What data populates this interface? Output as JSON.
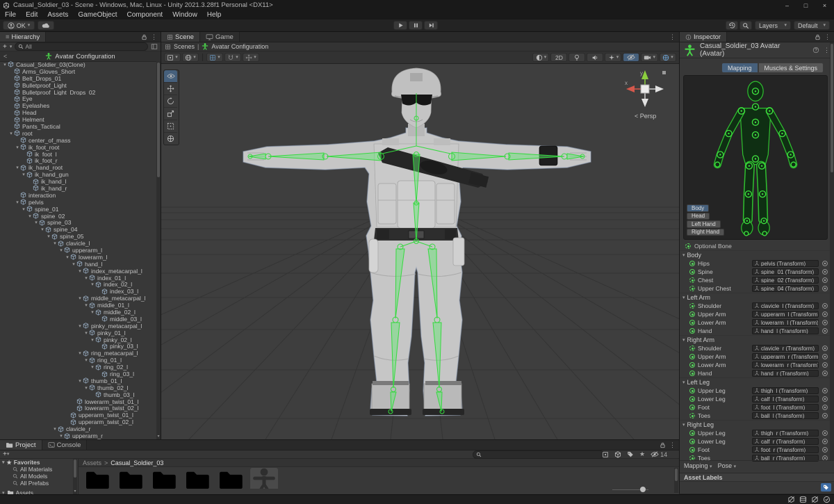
{
  "titlebar": {
    "title": "Casual_Soldier_03 - Scene - Windows, Mac, Linux - Unity 2021.3.28f1 Personal <DX11>"
  },
  "menubar": {
    "items": [
      {
        "label": "File"
      },
      {
        "label": "Edit"
      },
      {
        "label": "Assets"
      },
      {
        "label": "GameObject"
      },
      {
        "label": "Component"
      },
      {
        "label": "Window"
      },
      {
        "label": "Help"
      }
    ]
  },
  "toolbar": {
    "account": "OK",
    "layers": "Layers",
    "layout": "Default"
  },
  "glyphs": {
    "caret": "▾",
    "caret_right": "▸",
    "kebab": "⋮",
    "burger": "≡",
    "plus": "+",
    "star": "★",
    "back": "<",
    "pipe": "|",
    "crumb": ">",
    "minimize": "–",
    "maximize": "□",
    "close": "×"
  },
  "hierarchy": {
    "tab": "Hierarchy",
    "search_value": "All",
    "header": "Avatar Configuration",
    "items": [
      {
        "label": "Casual_Soldier_03(Clone)",
        "depth": 0,
        "expanded": true
      },
      {
        "label": "Arms_Gloves_Short",
        "depth": 1,
        "expanded": false
      },
      {
        "label": "Belt_Drops_01",
        "depth": 1,
        "expanded": false
      },
      {
        "label": "Bulletproof_Light",
        "depth": 1,
        "expanded": false
      },
      {
        "label": "Bulletproof_Light_Drops_02",
        "depth": 1,
        "expanded": false
      },
      {
        "label": "Eye",
        "depth": 1,
        "expanded": false
      },
      {
        "label": "Eyelashes",
        "depth": 1,
        "expanded": false
      },
      {
        "label": "Head",
        "depth": 1,
        "expanded": false
      },
      {
        "label": "Helment",
        "depth": 1,
        "expanded": false
      },
      {
        "label": "Pants_Tactical",
        "depth": 1,
        "expanded": false
      },
      {
        "label": "root",
        "depth": 1,
        "expanded": true
      },
      {
        "label": "center_of_mass",
        "depth": 2,
        "expanded": false
      },
      {
        "label": "ik_foot_root",
        "depth": 2,
        "expanded": true
      },
      {
        "label": "ik_foot_l",
        "depth": 3,
        "expanded": false
      },
      {
        "label": "ik_foot_r",
        "depth": 3,
        "expanded": false
      },
      {
        "label": "ik_hand_root",
        "depth": 2,
        "expanded": true
      },
      {
        "label": "ik_hand_gun",
        "depth": 3,
        "expanded": true
      },
      {
        "label": "ik_hand_l",
        "depth": 4,
        "expanded": false
      },
      {
        "label": "ik_hand_r",
        "depth": 4,
        "expanded": false
      },
      {
        "label": "interaction",
        "depth": 2,
        "expanded": false
      },
      {
        "label": "pelvis",
        "depth": 2,
        "expanded": true
      },
      {
        "label": "spine_01",
        "depth": 3,
        "expanded": true
      },
      {
        "label": "spine_02",
        "depth": 4,
        "expanded": true
      },
      {
        "label": "spine_03",
        "depth": 5,
        "expanded": true
      },
      {
        "label": "spine_04",
        "depth": 6,
        "expanded": true
      },
      {
        "label": "spine_05",
        "depth": 7,
        "expanded": true
      },
      {
        "label": "clavicle_l",
        "depth": 8,
        "expanded": true
      },
      {
        "label": "upperarm_l",
        "depth": 9,
        "expanded": true
      },
      {
        "label": "lowerarm_l",
        "depth": 10,
        "expanded": true
      },
      {
        "label": "hand_l",
        "depth": 11,
        "expanded": true
      },
      {
        "label": "index_metacarpal_l",
        "depth": 12,
        "expanded": true
      },
      {
        "label": "index_01_l",
        "depth": 13,
        "expanded": true
      },
      {
        "label": "index_02_l",
        "depth": 14,
        "expanded": true
      },
      {
        "label": "index_03_l",
        "depth": 15,
        "expanded": false
      },
      {
        "label": "middle_metacarpal_l",
        "depth": 12,
        "expanded": true
      },
      {
        "label": "middle_01_l",
        "depth": 13,
        "expanded": true
      },
      {
        "label": "middle_02_l",
        "depth": 14,
        "expanded": true
      },
      {
        "label": "middle_03_l",
        "depth": 15,
        "expanded": false
      },
      {
        "label": "pinky_metacarpal_l",
        "depth": 12,
        "expanded": true
      },
      {
        "label": "pinky_01_l",
        "depth": 13,
        "expanded": true
      },
      {
        "label": "pinky_02_l",
        "depth": 14,
        "expanded": true
      },
      {
        "label": "pinky_03_l",
        "depth": 15,
        "expanded": false
      },
      {
        "label": "ring_metacarpal_l",
        "depth": 12,
        "expanded": true
      },
      {
        "label": "ring_01_l",
        "depth": 13,
        "expanded": true
      },
      {
        "label": "ring_02_l",
        "depth": 14,
        "expanded": true
      },
      {
        "label": "ring_03_l",
        "depth": 15,
        "expanded": false
      },
      {
        "label": "thumb_01_l",
        "depth": 12,
        "expanded": true
      },
      {
        "label": "thumb_02_l",
        "depth": 13,
        "expanded": true
      },
      {
        "label": "thumb_03_l",
        "depth": 14,
        "expanded": false
      },
      {
        "label": "lowerarm_twist_01_l",
        "depth": 11,
        "expanded": false
      },
      {
        "label": "lowerarm_twist_02_l",
        "depth": 11,
        "expanded": false
      },
      {
        "label": "upperarm_twist_01_l",
        "depth": 10,
        "expanded": false
      },
      {
        "label": "upperarm_twist_02_l",
        "depth": 10,
        "expanded": false
      },
      {
        "label": "clavicle_r",
        "depth": 8,
        "expanded": true
      },
      {
        "label": "upperarm_r",
        "depth": 9,
        "expanded": true
      }
    ]
  },
  "scene": {
    "tab_scene": "Scene",
    "tab_game": "Game",
    "breadcrumb_scenes": "Scenes",
    "breadcrumb_config": "Avatar Configuration",
    "mode_2d": "2D",
    "gizmo": {
      "persp": "< Persp",
      "x": "x",
      "y": "y"
    }
  },
  "inspector": {
    "tab": "Inspector",
    "title": "Casual_Soldier_03 Avatar (Avatar)",
    "tab_mapping": "Mapping",
    "tab_muscles": "Muscles & Settings",
    "body_part_buttons": [
      {
        "label": "Body",
        "active": true
      },
      {
        "label": "Head",
        "active": false
      },
      {
        "label": "Left Hand",
        "active": false
      },
      {
        "label": "Right Hand",
        "active": false
      }
    ],
    "optional_bone": "Optional Bone",
    "sections": [
      {
        "name": "Body",
        "rows": [
          {
            "label": "Hips",
            "value": "pelvis (Transform)",
            "optional": false
          },
          {
            "label": "Spine",
            "value": "spine_01 (Transform)",
            "optional": false
          },
          {
            "label": "Chest",
            "value": "spine_02 (Transform)",
            "optional": true
          },
          {
            "label": "Upper Chest",
            "value": "spine_04 (Transform)",
            "optional": true
          }
        ]
      },
      {
        "name": "Left Arm",
        "rows": [
          {
            "label": "Shoulder",
            "value": "clavicle_l (Transform)",
            "optional": true
          },
          {
            "label": "Upper Arm",
            "value": "upperarm_l (Transform)",
            "optional": false
          },
          {
            "label": "Lower Arm",
            "value": "lowerarm_l (Transform)",
            "optional": false
          },
          {
            "label": "Hand",
            "value": "hand_l (Transform)",
            "optional": false
          }
        ]
      },
      {
        "name": "Right Arm",
        "rows": [
          {
            "label": "Shoulder",
            "value": "clavicle_r (Transform)",
            "optional": true
          },
          {
            "label": "Upper Arm",
            "value": "upperarm_r (Transform)",
            "optional": false
          },
          {
            "label": "Lower Arm",
            "value": "lowerarm_r (Transform)",
            "optional": false
          },
          {
            "label": "Hand",
            "value": "hand_r (Transform)",
            "optional": false
          }
        ]
      },
      {
        "name": "Left Leg",
        "rows": [
          {
            "label": "Upper Leg",
            "value": "thigh_l (Transform)",
            "optional": false
          },
          {
            "label": "Lower Leg",
            "value": "calf_l (Transform)",
            "optional": false
          },
          {
            "label": "Foot",
            "value": "foot_l (Transform)",
            "optional": false
          },
          {
            "label": "Toes",
            "value": "ball_l (Transform)",
            "optional": true
          }
        ]
      },
      {
        "name": "Right Leg",
        "rows": [
          {
            "label": "Upper Leg",
            "value": "thigh_r (Transform)",
            "optional": false
          },
          {
            "label": "Lower Leg",
            "value": "calf_r (Transform)",
            "optional": false
          },
          {
            "label": "Foot",
            "value": "foot_r (Transform)",
            "optional": false
          },
          {
            "label": "Toes",
            "value": "ball_r (Transform)",
            "optional": true
          }
        ]
      }
    ],
    "footer_mapping": "Mapping",
    "footer_pose": "Pose",
    "asset_labels": "Asset Labels"
  },
  "project": {
    "tab_project": "Project",
    "tab_console": "Console",
    "favorites_label": "Favorites",
    "favorites": [
      {
        "label": "All Materials"
      },
      {
        "label": "All Models"
      },
      {
        "label": "All Prefabs"
      }
    ],
    "assets_root_label": "Assets",
    "breadcrumb_root": "Assets",
    "breadcrumb_current": "Casual_Soldier_03",
    "hidden_count": "14",
    "tiles": [
      {
        "kind": "folder"
      },
      {
        "kind": "folder"
      },
      {
        "kind": "folder"
      },
      {
        "kind": "folder-filled"
      },
      {
        "kind": "folder"
      },
      {
        "kind": "prefab"
      }
    ]
  },
  "colors": {
    "accent_selected": "#46607c",
    "bone_green": "#56d45c",
    "avatar_green": "#4ad54a",
    "viewport_bg": "#3e3e3e",
    "label_tag_blue": "#3e6ca3"
  }
}
